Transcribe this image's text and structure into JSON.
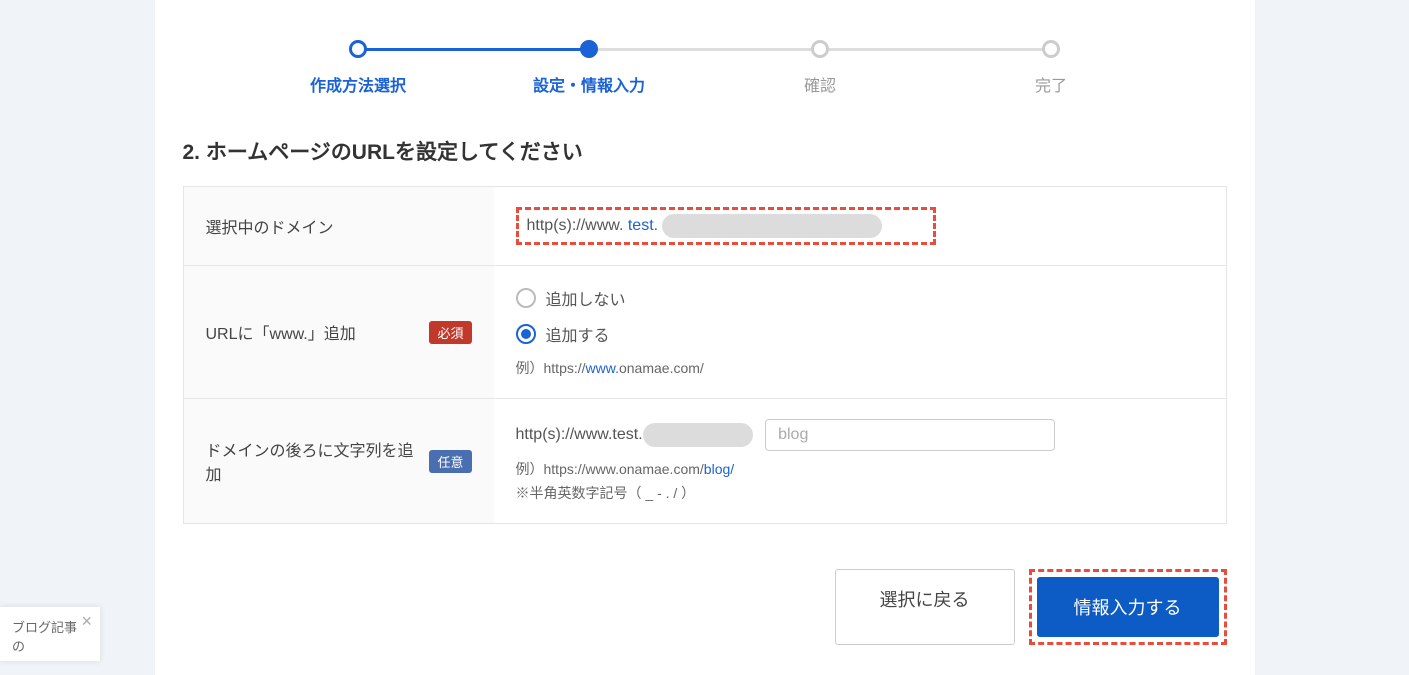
{
  "steps": [
    {
      "label": "作成方法選択",
      "state": "done"
    },
    {
      "label": "設定・情報入力",
      "state": "current"
    },
    {
      "label": "確認",
      "state": "pending"
    },
    {
      "label": "完了",
      "state": "pending"
    }
  ],
  "heading": "2. ホームページのURLを設定してください",
  "rows": {
    "selected_domain": {
      "label": "選択中のドメイン",
      "prefix": "http(s)://www. ",
      "value_visible": "test."
    },
    "www_add": {
      "label": "URLに「www.」追加",
      "badge": "必須",
      "option_no": "追加しない",
      "option_yes": "追加する",
      "selected": "yes",
      "example_prefix": "例）https://",
      "example_highlight": "www.",
      "example_suffix": "onamae.com/"
    },
    "suffix": {
      "label": "ドメインの後ろに文字列を追加",
      "badge": "任意",
      "prefix": "http(s)://www.test.",
      "input_placeholder": "blog",
      "example_prefix": "例）https://www.onamae.com/",
      "example_highlight": "blog/",
      "note": "※半角英数字記号（ _ - . / ）"
    }
  },
  "buttons": {
    "back": "選択に戻る",
    "next": "情報入力する"
  },
  "popup": {
    "text": "ブログ記事の",
    "close": "×"
  }
}
